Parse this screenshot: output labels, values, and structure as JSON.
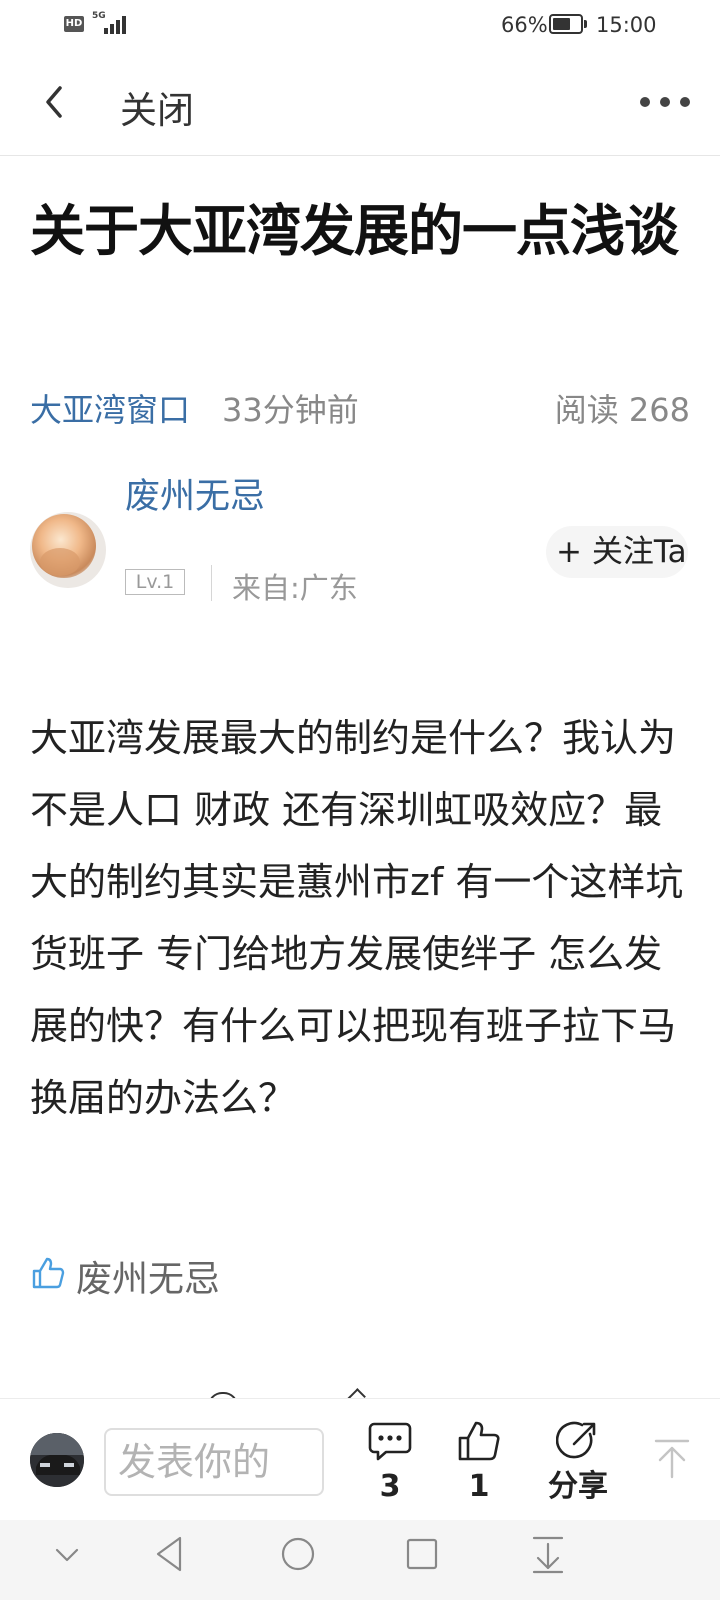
{
  "status_bar": {
    "hd_badge": "HD",
    "network": "5G",
    "battery_percent": "66%",
    "battery_level": 0.66,
    "time": "15:00"
  },
  "header": {
    "back_icon": "chevron-left-icon",
    "close_label": "关闭",
    "more_icon": "more-horizontal-icon"
  },
  "article": {
    "title": "关于大亚湾发展的一点浅谈",
    "source": "大亚湾窗口",
    "time_ago": "33分钟前",
    "read_count": "阅读 268",
    "author": {
      "name": "废州无忌",
      "level": "Lv.1",
      "location": "来自:广东",
      "follow_label": "+ 关注Ta"
    },
    "body": "大亚湾发展最大的制约是什么？我认为不是人口 财政 还有深圳虹吸效应？最大的制约其实是蕙州市zf 有一个这样坑货班子 专门给地方发展使绊子 怎么发展的快？有什么可以把现有班子拉下马换届的办法么？",
    "liked_by": "废州无忌"
  },
  "bottom_bar": {
    "comment_placeholder": "发表你的",
    "comment_count": "3",
    "like_count": "1",
    "share_label": "分享",
    "icons": [
      "comment-icon",
      "thumbs-up-icon",
      "share-icon",
      "scroll-to-top-icon"
    ]
  },
  "system_nav": {
    "icons": [
      "chevron-down-icon",
      "back-triangle-icon",
      "home-circle-icon",
      "recents-square-icon",
      "download-icon"
    ]
  },
  "colors": {
    "link_blue": "#3a6ea5",
    "like_blue": "#4a9fe0",
    "text_dark": "#222222",
    "text_gray": "#888888"
  }
}
